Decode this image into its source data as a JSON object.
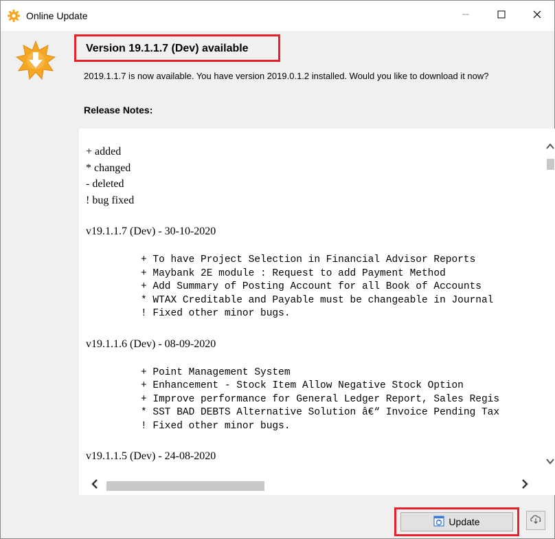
{
  "window": {
    "title": "Online Update",
    "controls": {
      "minimize_icon": "minimize-icon",
      "maximize_icon": "maximize-icon",
      "close_icon": "close-icon"
    }
  },
  "header": {
    "icon": "download-starburst-icon",
    "version_title": "Version 19.1.1.7 (Dev) available",
    "availability_text": "2019.1.1.7 is now available. You have version 2019.0.1.2 installed. Would you like to download it now?",
    "release_notes_label": "Release Notes:"
  },
  "release_notes": {
    "legend": [
      "+ added",
      "* changed",
      "- deleted",
      "! bug fixed"
    ],
    "versions": [
      {
        "heading": "v19.1.1.7 (Dev) - 30-10-2020",
        "items": [
          "+ To have Project Selection in Financial Advisor Reports",
          "+ Maybank 2E module : Request to add Payment Method",
          "+ Add Summary of Posting Account for all Book of Accounts",
          "* WTAX Creditable and Payable must be changeable in Journal",
          "! Fixed other minor bugs."
        ]
      },
      {
        "heading": "v19.1.1.6 (Dev) - 08-09-2020",
        "items": [
          "+ Point Management System",
          "+ Enhancement - Stock Item Allow Negative Stock Option",
          "+ Improve performance for General Ledger Report, Sales Regis",
          "* SST BAD DEBTS Alternative Solution â€“ Invoice Pending Tax",
          "! Fixed other minor bugs."
        ]
      },
      {
        "heading": "v19.1.1.5 (Dev) - 24-08-2020",
        "items": []
      }
    ]
  },
  "buttons": {
    "update_label": "Update",
    "update_icon": "update-icon",
    "download_cloud_icon": "cloud-download-icon"
  },
  "colors": {
    "highlight": "#e8202a",
    "icon_orange": "#f5a623"
  }
}
